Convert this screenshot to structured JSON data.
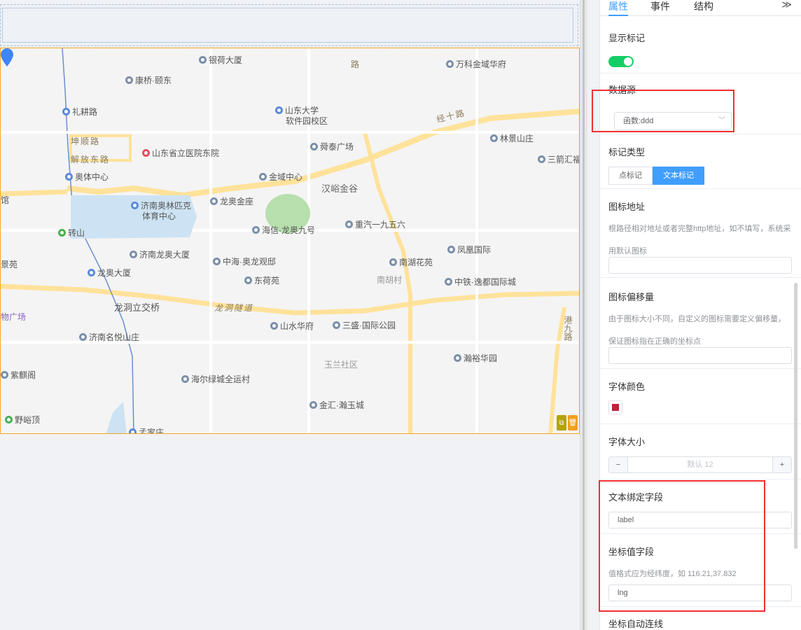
{
  "map": {
    "pois": [
      {
        "name": "银荷大厦",
        "icon": "building-icon"
      },
      {
        "name": "康桥·颐东",
        "icon": "building-icon"
      },
      {
        "name": "礼耕路",
        "icon": "metro-icon"
      },
      {
        "name": "山东大学",
        "icon": "school-icon"
      },
      {
        "name": "软件园校区",
        "icon": "none"
      },
      {
        "name": "万科金域华府",
        "icon": "building-icon"
      },
      {
        "name": "坤顺路",
        "icon": "none"
      },
      {
        "name": "解放东路",
        "icon": "none"
      },
      {
        "name": "山东省立医院东院",
        "icon": "hospital-icon"
      },
      {
        "name": "舜泰广场",
        "icon": "building-icon"
      },
      {
        "name": "林景山庄",
        "icon": "building-icon"
      },
      {
        "name": "三箭汇福",
        "icon": "building-icon"
      },
      {
        "name": "奥体中心",
        "icon": "metro-icon"
      },
      {
        "name": "金域中心",
        "icon": "building-icon"
      },
      {
        "name": "汉峪金谷",
        "icon": "none"
      },
      {
        "name": "济南奥林匹克",
        "icon": "stadium-icon"
      },
      {
        "name": "体育中心",
        "icon": "none"
      },
      {
        "name": "龙奥金座",
        "icon": "building-icon"
      },
      {
        "name": "转山",
        "icon": "park-icon"
      },
      {
        "name": "海信·龙奥九号",
        "icon": "building-icon"
      },
      {
        "name": "重汽一九五六",
        "icon": "building-icon"
      },
      {
        "name": "凤凰国际",
        "icon": "building-icon"
      },
      {
        "name": "济南龙奥大厦",
        "icon": "building-icon"
      },
      {
        "name": "中海·奥龙观邸",
        "icon": "building-icon"
      },
      {
        "name": "南湖花苑",
        "icon": "building-icon"
      },
      {
        "name": "景苑",
        "icon": "none"
      },
      {
        "name": "龙奥大厦",
        "icon": "metro-icon"
      },
      {
        "name": "东荷苑",
        "icon": "building-icon"
      },
      {
        "name": "南胡村",
        "icon": "none"
      },
      {
        "name": "中铁·逸都国际城",
        "icon": "building-icon"
      },
      {
        "name": "龙洞立交桥",
        "icon": "none"
      },
      {
        "name": "龙洞隧道",
        "icon": "none"
      },
      {
        "name": "物广场",
        "icon": "none"
      },
      {
        "name": "山水华府",
        "icon": "building-icon"
      },
      {
        "name": "三盛·国际公园",
        "icon": "building-icon"
      },
      {
        "name": "港九路",
        "icon": "none"
      },
      {
        "name": "济南名悦山庄",
        "icon": "building-icon"
      },
      {
        "name": "玉兰社区",
        "icon": "none"
      },
      {
        "name": "瀚裕华园",
        "icon": "building-icon"
      },
      {
        "name": "紫麒阁",
        "icon": "building-icon"
      },
      {
        "name": "海尔绿城全运村",
        "icon": "building-icon"
      },
      {
        "name": "金汇·瀚玉城",
        "icon": "building-icon"
      },
      {
        "name": "野峪顶",
        "icon": "park-icon"
      },
      {
        "name": "孟家庄",
        "icon": "metro-icon"
      },
      {
        "name": "经十路",
        "icon": "none"
      },
      {
        "name": "路",
        "icon": "none"
      },
      {
        "name": "馆",
        "icon": "none"
      }
    ]
  },
  "panel": {
    "tabs": [
      "属性",
      "事件",
      "结构"
    ],
    "collapse_icon": "double-chevron-right-icon",
    "show_marker": {
      "label": "显示标记",
      "on": true
    },
    "datasource": {
      "label": "数据源",
      "value": "函数:ddd"
    },
    "marker_type": {
      "label": "标记类型",
      "options": [
        "点标记",
        "文本标记"
      ],
      "selected": "文本标记"
    },
    "icon_url": {
      "label": "图标地址",
      "hint": "根路径相对地址或者完整http地址，如不填写，系统采用默认图标",
      "value": ""
    },
    "icon_offset": {
      "label": "图标偏移量",
      "hint": "由于图标大小不同，自定义的图标需要定义偏移量，保证图标指在正确的坐标点",
      "value": ""
    },
    "font_color": {
      "label": "字体颜色",
      "color": "#c81e3a"
    },
    "font_size": {
      "label": "字体大小",
      "placeholder": "默认 12",
      "minus": "−",
      "plus": "+"
    },
    "text_field": {
      "label": "文本绑定字段",
      "value": "label"
    },
    "coord_field": {
      "label": "坐标值字段",
      "hint": "值格式应为经纬度，如 116.21,37.832",
      "value": "lng"
    },
    "auto_connect": {
      "label": "坐标自动连线"
    }
  },
  "colors": {
    "accent": "#409eff",
    "switch_on": "#13ce66",
    "highlight": "#f03030",
    "map_border": "#f5a623"
  }
}
